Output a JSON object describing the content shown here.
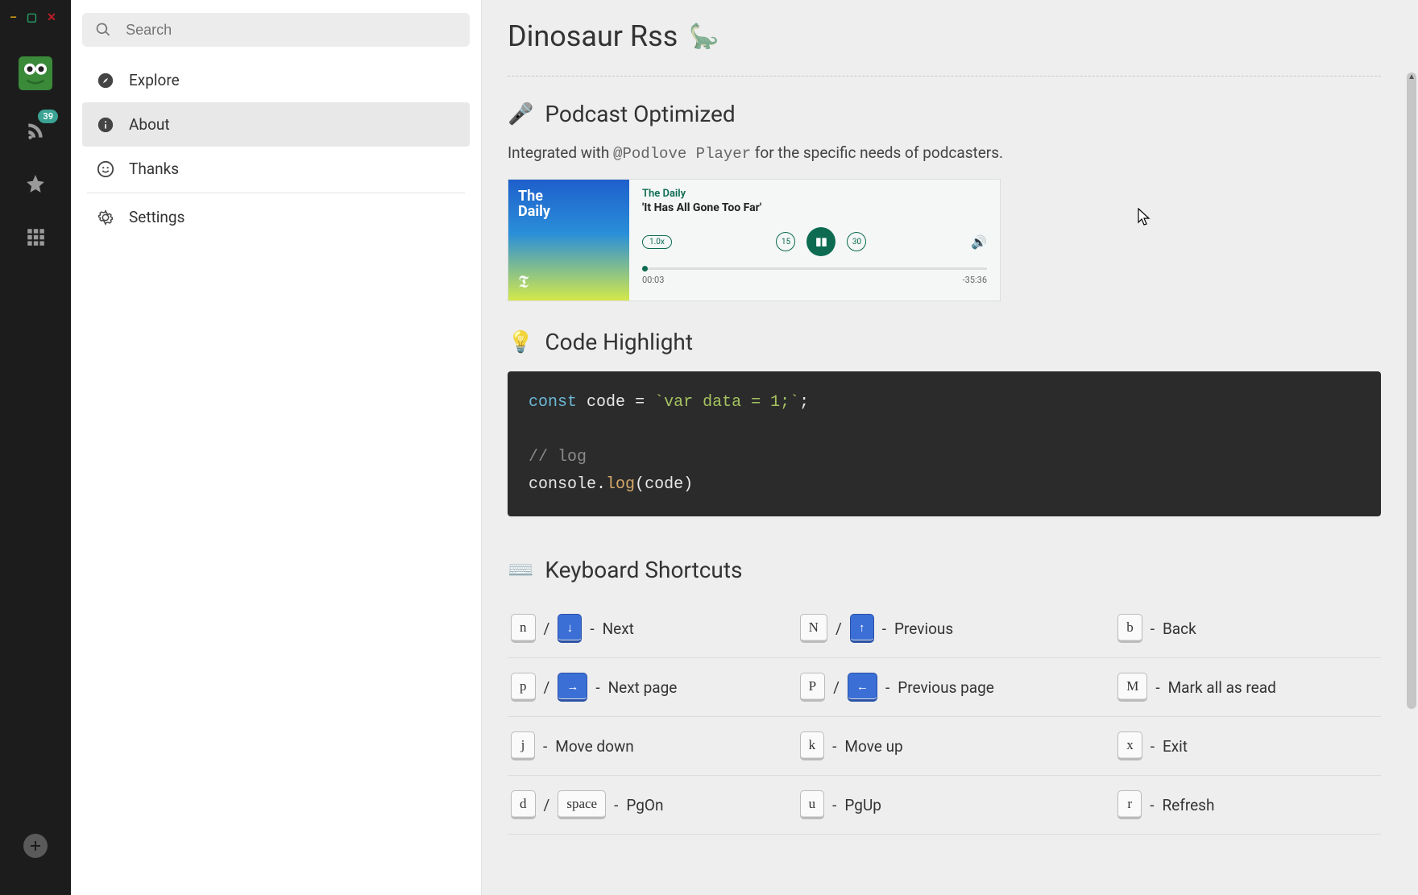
{
  "window": {
    "min": "–",
    "max": "▢",
    "close": "✕"
  },
  "rail": {
    "badge": "39",
    "add": "+"
  },
  "sidebar": {
    "search_placeholder": "Search",
    "items": [
      {
        "label": "Explore"
      },
      {
        "label": "About"
      },
      {
        "label": "Thanks"
      },
      {
        "label": "Settings"
      }
    ]
  },
  "page": {
    "title": "Dinosaur Rss"
  },
  "podcast_section": {
    "heading": "Podcast Optimized",
    "intro_pre": "Integrated with ",
    "intro_mid": "@Podlove Player",
    "intro_post": " for the specific needs of podcasters.",
    "player": {
      "art_line1": "The",
      "art_line2": "Daily",
      "publisher": "The Daily",
      "episode": "'It Has All Gone Too Far'",
      "speed": "1.0x",
      "back": "15",
      "fwd": "30",
      "time_current": "00:03",
      "time_remaining": "-35:36"
    }
  },
  "code_section": {
    "heading": "Code Highlight",
    "tok_const": "const",
    "tok_code": "code",
    "tok_eq": "=",
    "tok_str": "`var data = 1;`",
    "tok_semi": ";",
    "tok_cmt": "// log",
    "tok_console": "console",
    "tok_dot": ".",
    "tok_log": "log",
    "tok_open": "(",
    "tok_arg": "code",
    "tok_close": ")"
  },
  "shortcuts_section": {
    "heading": "Keyboard Shortcuts",
    "rows": [
      [
        {
          "keys": [
            "n",
            "/",
            "↓"
          ],
          "blueAt": [
            2
          ],
          "desc": "Next"
        },
        {
          "keys": [
            "N",
            "/",
            "↑"
          ],
          "blueAt": [
            2
          ],
          "desc": "Previous"
        },
        {
          "keys": [
            "b"
          ],
          "desc": "Back"
        }
      ],
      [
        {
          "keys": [
            "p",
            "/",
            "→"
          ],
          "blueAt": [
            2
          ],
          "desc": "Next page"
        },
        {
          "keys": [
            "P",
            "/",
            "←"
          ],
          "blueAt": [
            2
          ],
          "desc": "Previous page"
        },
        {
          "keys": [
            "M"
          ],
          "desc": "Mark all as read"
        }
      ],
      [
        {
          "keys": [
            "j"
          ],
          "desc": "Move down"
        },
        {
          "keys": [
            "k"
          ],
          "desc": "Move up"
        },
        {
          "keys": [
            "x"
          ],
          "desc": "Exit"
        }
      ],
      [
        {
          "keys": [
            "d",
            "/",
            "space"
          ],
          "desc": "PgOn"
        },
        {
          "keys": [
            "u"
          ],
          "desc": "PgUp"
        },
        {
          "keys": [
            "r"
          ],
          "desc": "Refresh"
        }
      ]
    ]
  }
}
